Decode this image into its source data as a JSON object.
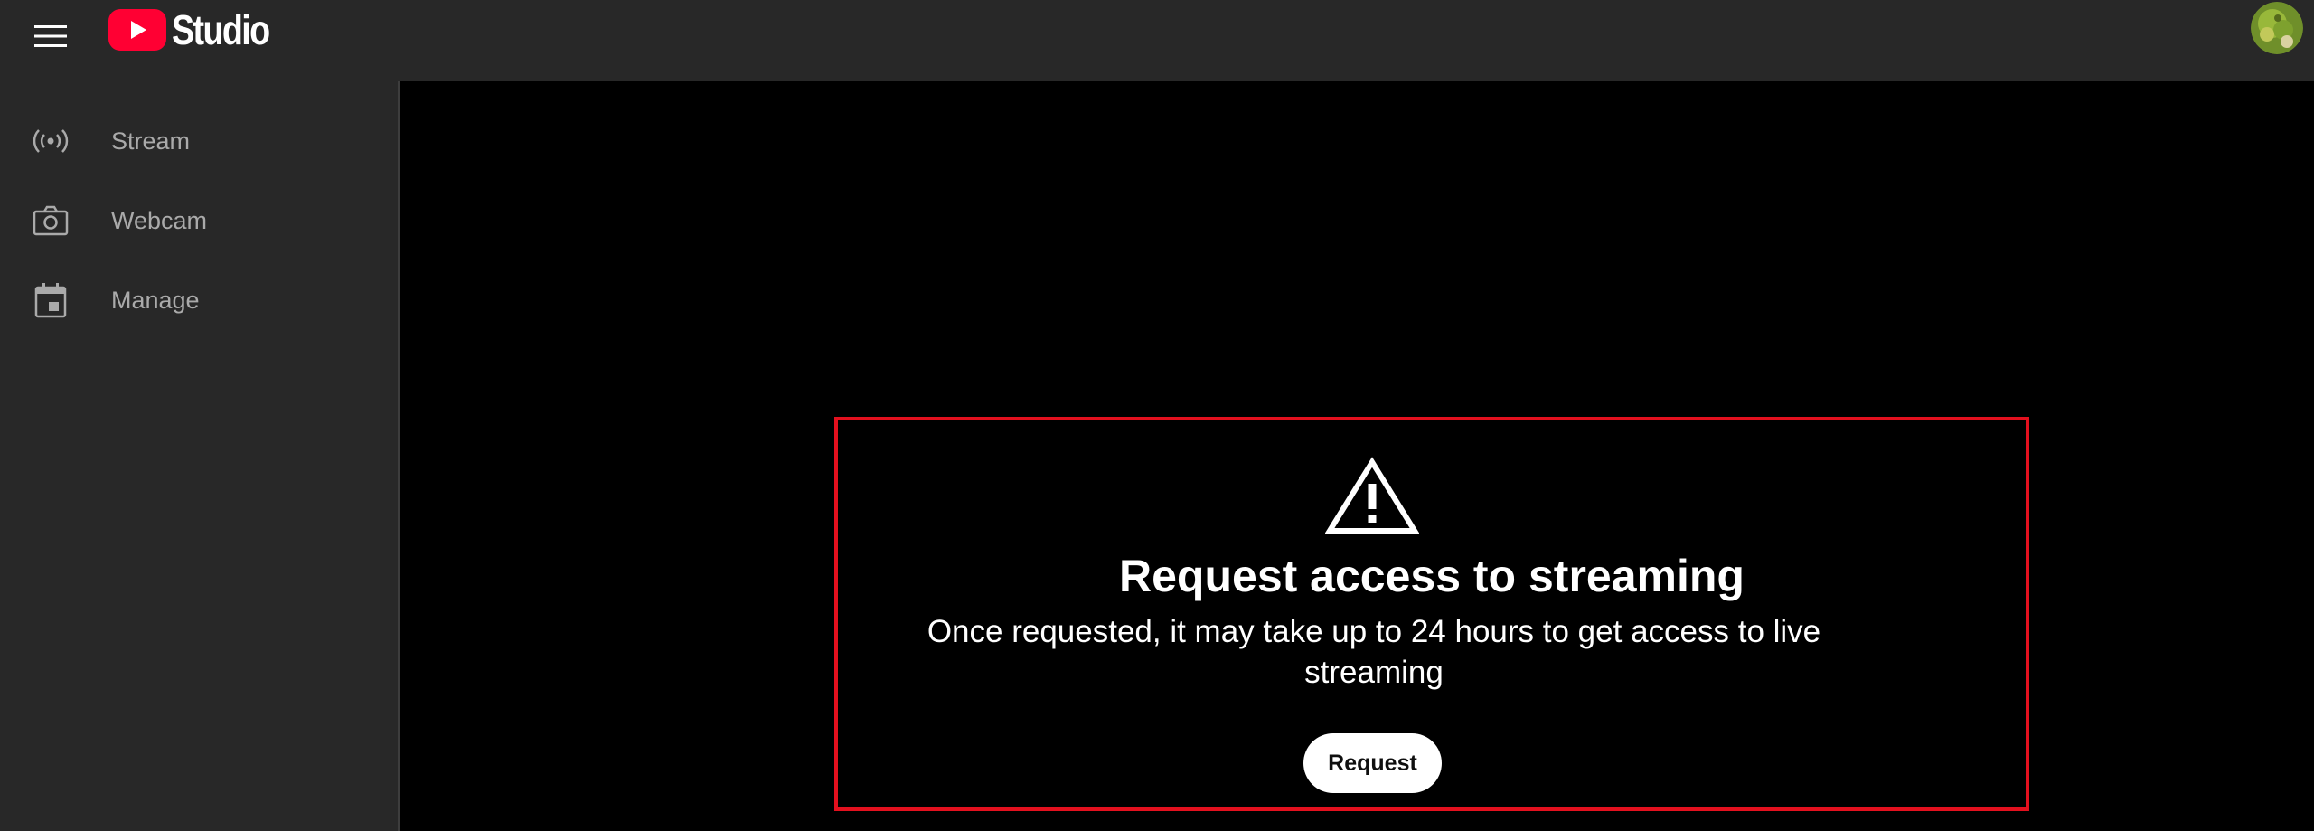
{
  "header": {
    "menu_icon": "hamburger-menu-icon",
    "logo_text": "Studio",
    "logo_icon": "youtube-play-icon",
    "brand_color": "#ff0033",
    "avatar_icon": "account-avatar"
  },
  "sidebar": {
    "items": [
      {
        "label": "Stream",
        "icon": "broadcast-icon"
      },
      {
        "label": "Webcam",
        "icon": "camera-icon"
      },
      {
        "label": "Manage",
        "icon": "calendar-icon"
      }
    ]
  },
  "notice": {
    "icon": "warning-icon",
    "title": "Request access to streaming",
    "description": "Once requested, it may take up to 24 hours to get access to live streaming",
    "button_label": "Request",
    "border_color": "#e3101e"
  }
}
